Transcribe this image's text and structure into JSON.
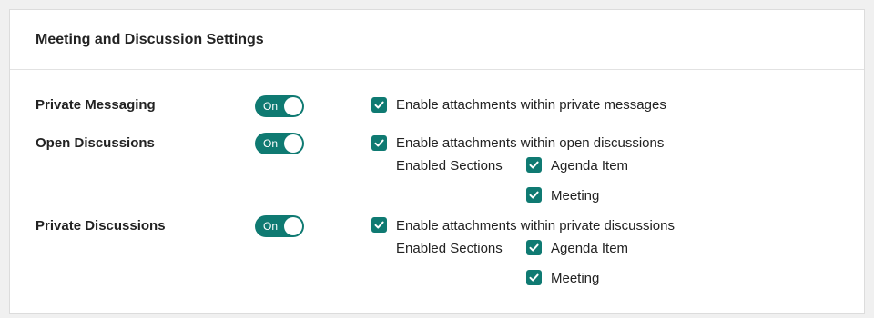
{
  "card": {
    "title": "Meeting and Discussion Settings"
  },
  "colors": {
    "accent": "#0f7a72",
    "page_background": "#f0f0f0",
    "card_background": "#ffffff"
  },
  "icons": {
    "checkbox": "checkmark-icon",
    "toggle_knob": "toggle-knob"
  },
  "settings": {
    "private_messaging": {
      "label": "Private Messaging",
      "toggle": {
        "state": "On",
        "checked": true
      },
      "attachments": {
        "label": "Enable attachments within private messages",
        "checked": true
      }
    },
    "open_discussions": {
      "label": "Open Discussions",
      "toggle": {
        "state": "On",
        "checked": true
      },
      "attachments": {
        "label": "Enable attachments within open discussions",
        "checked": true
      },
      "sections_label": "Enabled Sections",
      "sections": [
        {
          "label": "Agenda Item",
          "checked": true
        },
        {
          "label": "Meeting",
          "checked": true
        }
      ]
    },
    "private_discussions": {
      "label": "Private Discussions",
      "toggle": {
        "state": "On",
        "checked": true
      },
      "attachments": {
        "label": "Enable attachments within private discussions",
        "checked": true
      },
      "sections_label": "Enabled Sections",
      "sections": [
        {
          "label": "Agenda Item",
          "checked": true
        },
        {
          "label": "Meeting",
          "checked": true
        }
      ]
    }
  }
}
